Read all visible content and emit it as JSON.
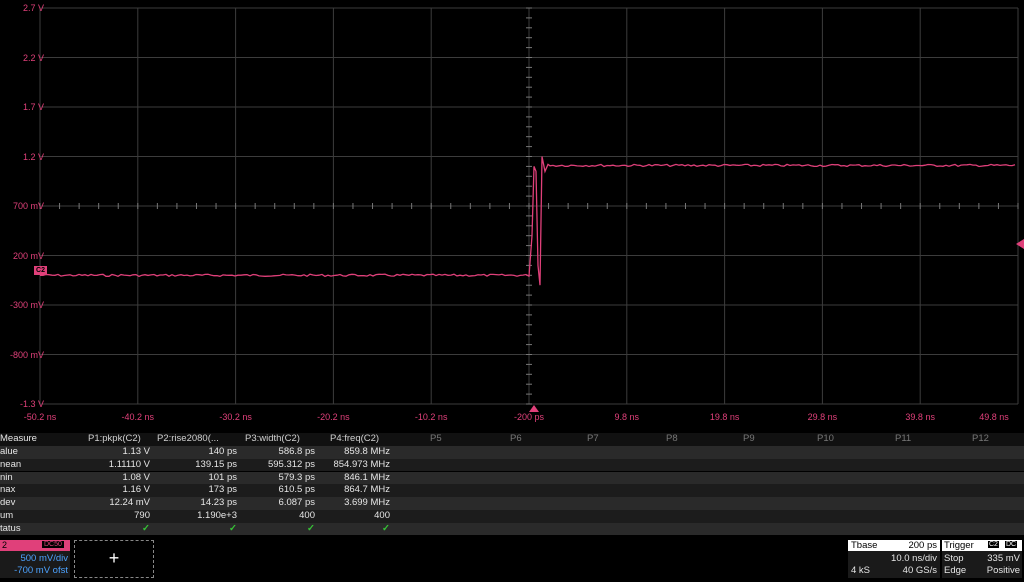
{
  "scope": {
    "y_labels": [
      "2.7 V",
      "2.2 V",
      "1.7 V",
      "1.2 V",
      "700 mV",
      "200 mV",
      "-300 mV",
      "-800 mV",
      "-1.3 V"
    ],
    "x_labels": [
      "-50.2 ns",
      "-40.2 ns",
      "-30.2 ns",
      "-20.2 ns",
      "-10.2 ns",
      "-200 ps",
      "9.8 ns",
      "19.8 ns",
      "29.8 ns",
      "39.8 ns",
      "49.8 ns"
    ],
    "channel_marker": "C2",
    "trace_color": "#e0407a",
    "grid_color": "#3c3c3c"
  },
  "measure": {
    "header_label": "Measure",
    "columns": [
      "P1:pkpk(C2)",
      "P2:rise2080(...",
      "P3:width(C2)",
      "P4:freq(C2)"
    ],
    "empty_params": [
      "P5",
      "P6",
      "P7",
      "P8",
      "P9",
      "P10",
      "P11",
      "P12"
    ],
    "rows": [
      {
        "label": "alue",
        "values": [
          "1.13 V",
          "140 ps",
          "586.8 ps",
          "859.8 MHz"
        ]
      },
      {
        "label": "nean",
        "values": [
          "1.11110 V",
          "139.15 ps",
          "595.312 ps",
          "854.973 MHz"
        ]
      },
      {
        "label": "nin",
        "values": [
          "1.08 V",
          "101 ps",
          "579.3 ps",
          "846.1 MHz"
        ]
      },
      {
        "label": "nax",
        "values": [
          "1.16 V",
          "173 ps",
          "610.5 ps",
          "864.7 MHz"
        ]
      },
      {
        "label": "dev",
        "values": [
          "12.24 mV",
          "14.23 ps",
          "6.087 ps",
          "3.699 MHz"
        ]
      },
      {
        "label": "um",
        "values": [
          "790",
          "1.190e+3",
          "400",
          "400"
        ]
      },
      {
        "label": "tatus",
        "values": [
          "✓",
          "✓",
          "✓",
          "✓"
        ]
      }
    ]
  },
  "channel_box": {
    "tag": "2",
    "badge": "DC50",
    "scale": "500 mV/div",
    "offset": "-700 mV ofst"
  },
  "add_button": {
    "label": "+"
  },
  "timebase": {
    "title": "Tbase",
    "delay": "200 ps",
    "div": "10.0 ns/div",
    "samples": "4 kS",
    "rate": "40 GS/s"
  },
  "trigger": {
    "title": "Trigger",
    "badge1": "C2",
    "badge2": "DC",
    "mode": "Stop",
    "level": "335 mV",
    "type": "Edge",
    "slope": "Positive"
  }
}
